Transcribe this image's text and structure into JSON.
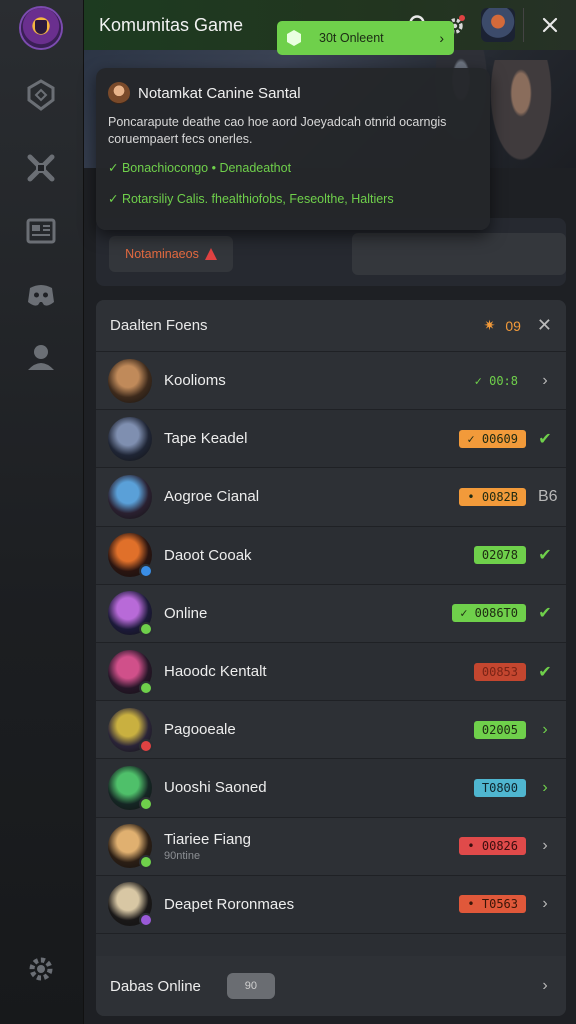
{
  "header": {
    "title": "Komumitas Game",
    "notification_dot_color": "#e04242"
  },
  "tooltip": {
    "title": "Notamkat Canine Santal",
    "body": "Poncarapute deathe cao hoe aord Joeyadcah otnrid ocarngis coruempaert fecs onerles.",
    "check1": "✓ Bonachiocongo • Denadeathot",
    "check2": "✓ Rotarsiliy Calis. fhealthiofobs, Feseolthe, Haltiers"
  },
  "actions": {
    "notifications_label": "Notaminaeos",
    "online_label": "30t Onleent",
    "online_arrow": "›"
  },
  "panel": {
    "title": "Daalten Foens",
    "count": "09",
    "close_glyph": "✕",
    "rows": [
      {
        "name": "Koolioms",
        "sub": "",
        "status": "✓ 00:8",
        "status_color": "#6fd04b",
        "status_bg": "transparent",
        "chev": "›",
        "chev_green": false,
        "ava_a": "#c08a5a",
        "ava_b": "#3d2a1c",
        "dot": ""
      },
      {
        "name": "Tape Keadel",
        "sub": "",
        "status": "✓ 00609",
        "status_color": "#1e2a12",
        "status_bg": "#f29a3a",
        "chev": "✔",
        "chev_green": true,
        "ava_a": "#7f8fb0",
        "ava_b": "#1f2535",
        "dot": ""
      },
      {
        "name": "Aogroe Cianal",
        "sub": "",
        "status": "• 0082B",
        "status_color": "#1e2a12",
        "status_bg": "#f29a3a",
        "chev": "B6",
        "chev_green": false,
        "ava_a": "#5aa0d8",
        "ava_b": "#2a2030",
        "dot": ""
      },
      {
        "name": "Daoot Cooak",
        "sub": "",
        "status": "02078",
        "status_color": "#1e2a12",
        "status_bg": "#6fd04b",
        "chev": "✔",
        "chev_green": true,
        "ava_a": "#e0702a",
        "ava_b": "#2a1410",
        "dot": "#3a8ee6"
      },
      {
        "name": "Online",
        "sub": "",
        "status": "✓ 0086T0",
        "status_color": "#1e2a12",
        "status_bg": "#6fd04b",
        "chev": "✔",
        "chev_green": true,
        "ava_a": "#b86ad8",
        "ava_b": "#1c1a3a",
        "dot": "#6fd04b"
      },
      {
        "name": "Haoodc Kentalt",
        "sub": "",
        "status": "00853",
        "status_color": "#7a2416",
        "status_bg": "#c4462f",
        "chev": "✔",
        "chev_green": true,
        "ava_a": "#d0508a",
        "ava_b": "#261628",
        "dot": "#6fd04b"
      },
      {
        "name": "Pagooeale",
        "sub": "",
        "status": "02005",
        "status_color": "#1e2a12",
        "status_bg": "#6fd04b",
        "chev": "›",
        "chev_green": true,
        "ava_a": "#c9b040",
        "ava_b": "#2a2438",
        "dot": "#e04242"
      },
      {
        "name": "Uooshi Saoned",
        "sub": "",
        "status": "T0800",
        "status_color": "#10252c",
        "status_bg": "#4fb6d0",
        "chev": "›",
        "chev_green": true,
        "ava_a": "#4fc06a",
        "ava_b": "#152624",
        "dot": "#6fd04b"
      },
      {
        "name": "Tiariee Fiang",
        "sub": "90ntine",
        "status": "• 00826",
        "status_color": "#3a0e0e",
        "status_bg": "#e04a4a",
        "chev": "›",
        "chev_green": false,
        "ava_a": "#e0b070",
        "ava_b": "#2b1e14",
        "dot": "#6fd04b"
      },
      {
        "name": "Deapet Roronmaes",
        "sub": "",
        "status": "• T0563",
        "status_color": "#3a1608",
        "status_bg": "#e0583a",
        "chev": "›",
        "chev_green": false,
        "ava_a": "#d8c7a4",
        "ava_b": "#1a1818",
        "dot": "#9a5ad8"
      }
    ],
    "footer_title": "Dabas Online",
    "footer_pill": "90",
    "footer_chev": "›"
  },
  "icons": {
    "rail": [
      "logo-icon",
      "shield-icon",
      "tools-icon",
      "news-icon",
      "discord-icon",
      "user-icon",
      "settings-icon"
    ],
    "header": [
      "search-icon",
      "gear-icon",
      "close-icon"
    ]
  },
  "colors": {
    "accent_green": "#6fd04b",
    "accent_orange": "#f29a3a",
    "header_bg": "#1d3b20"
  }
}
